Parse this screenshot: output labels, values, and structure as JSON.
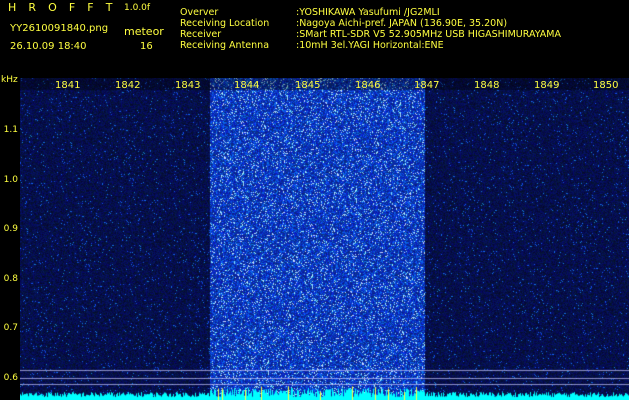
{
  "header": {
    "title": "H R O F F T",
    "version": "1.0.0f",
    "filename": "YY2610091840.png",
    "datetime": "26.10.09 18:40",
    "meteor_label": "meteor",
    "meteor_count": "16"
  },
  "station": [
    {
      "key": "Overver",
      "value": ":YOSHIKAWA Yasufumi /JG2MLI"
    },
    {
      "key": "Receiving Location",
      "value": ":Nagoya Aichi-pref. JAPAN (136.90E, 35.20N)"
    },
    {
      "key": "Receiver",
      "value": ":SMart RTL-SDR V5 52.905MHz USB HIGASHIMURAYAMA"
    },
    {
      "key": "Receiving Antenna",
      "value": ":10mH 3el.YAGI Horizontal:ENE"
    }
  ],
  "axes": {
    "y_unit": "kHz",
    "y_ticks": [
      "1.1",
      "1.0",
      "0.9",
      "0.8",
      "0.7",
      "0.6"
    ],
    "x_ticks": [
      "1841",
      "1842",
      "1843",
      "1844",
      "1845",
      "1846",
      "1847",
      "1848",
      "1849",
      "1850"
    ]
  },
  "colors": {
    "background": "#000000",
    "text": "#ffff40",
    "noise_dark": "#0a0a5a",
    "noise_bright": "#1a2ad0",
    "baseline": "#00ffff"
  }
}
